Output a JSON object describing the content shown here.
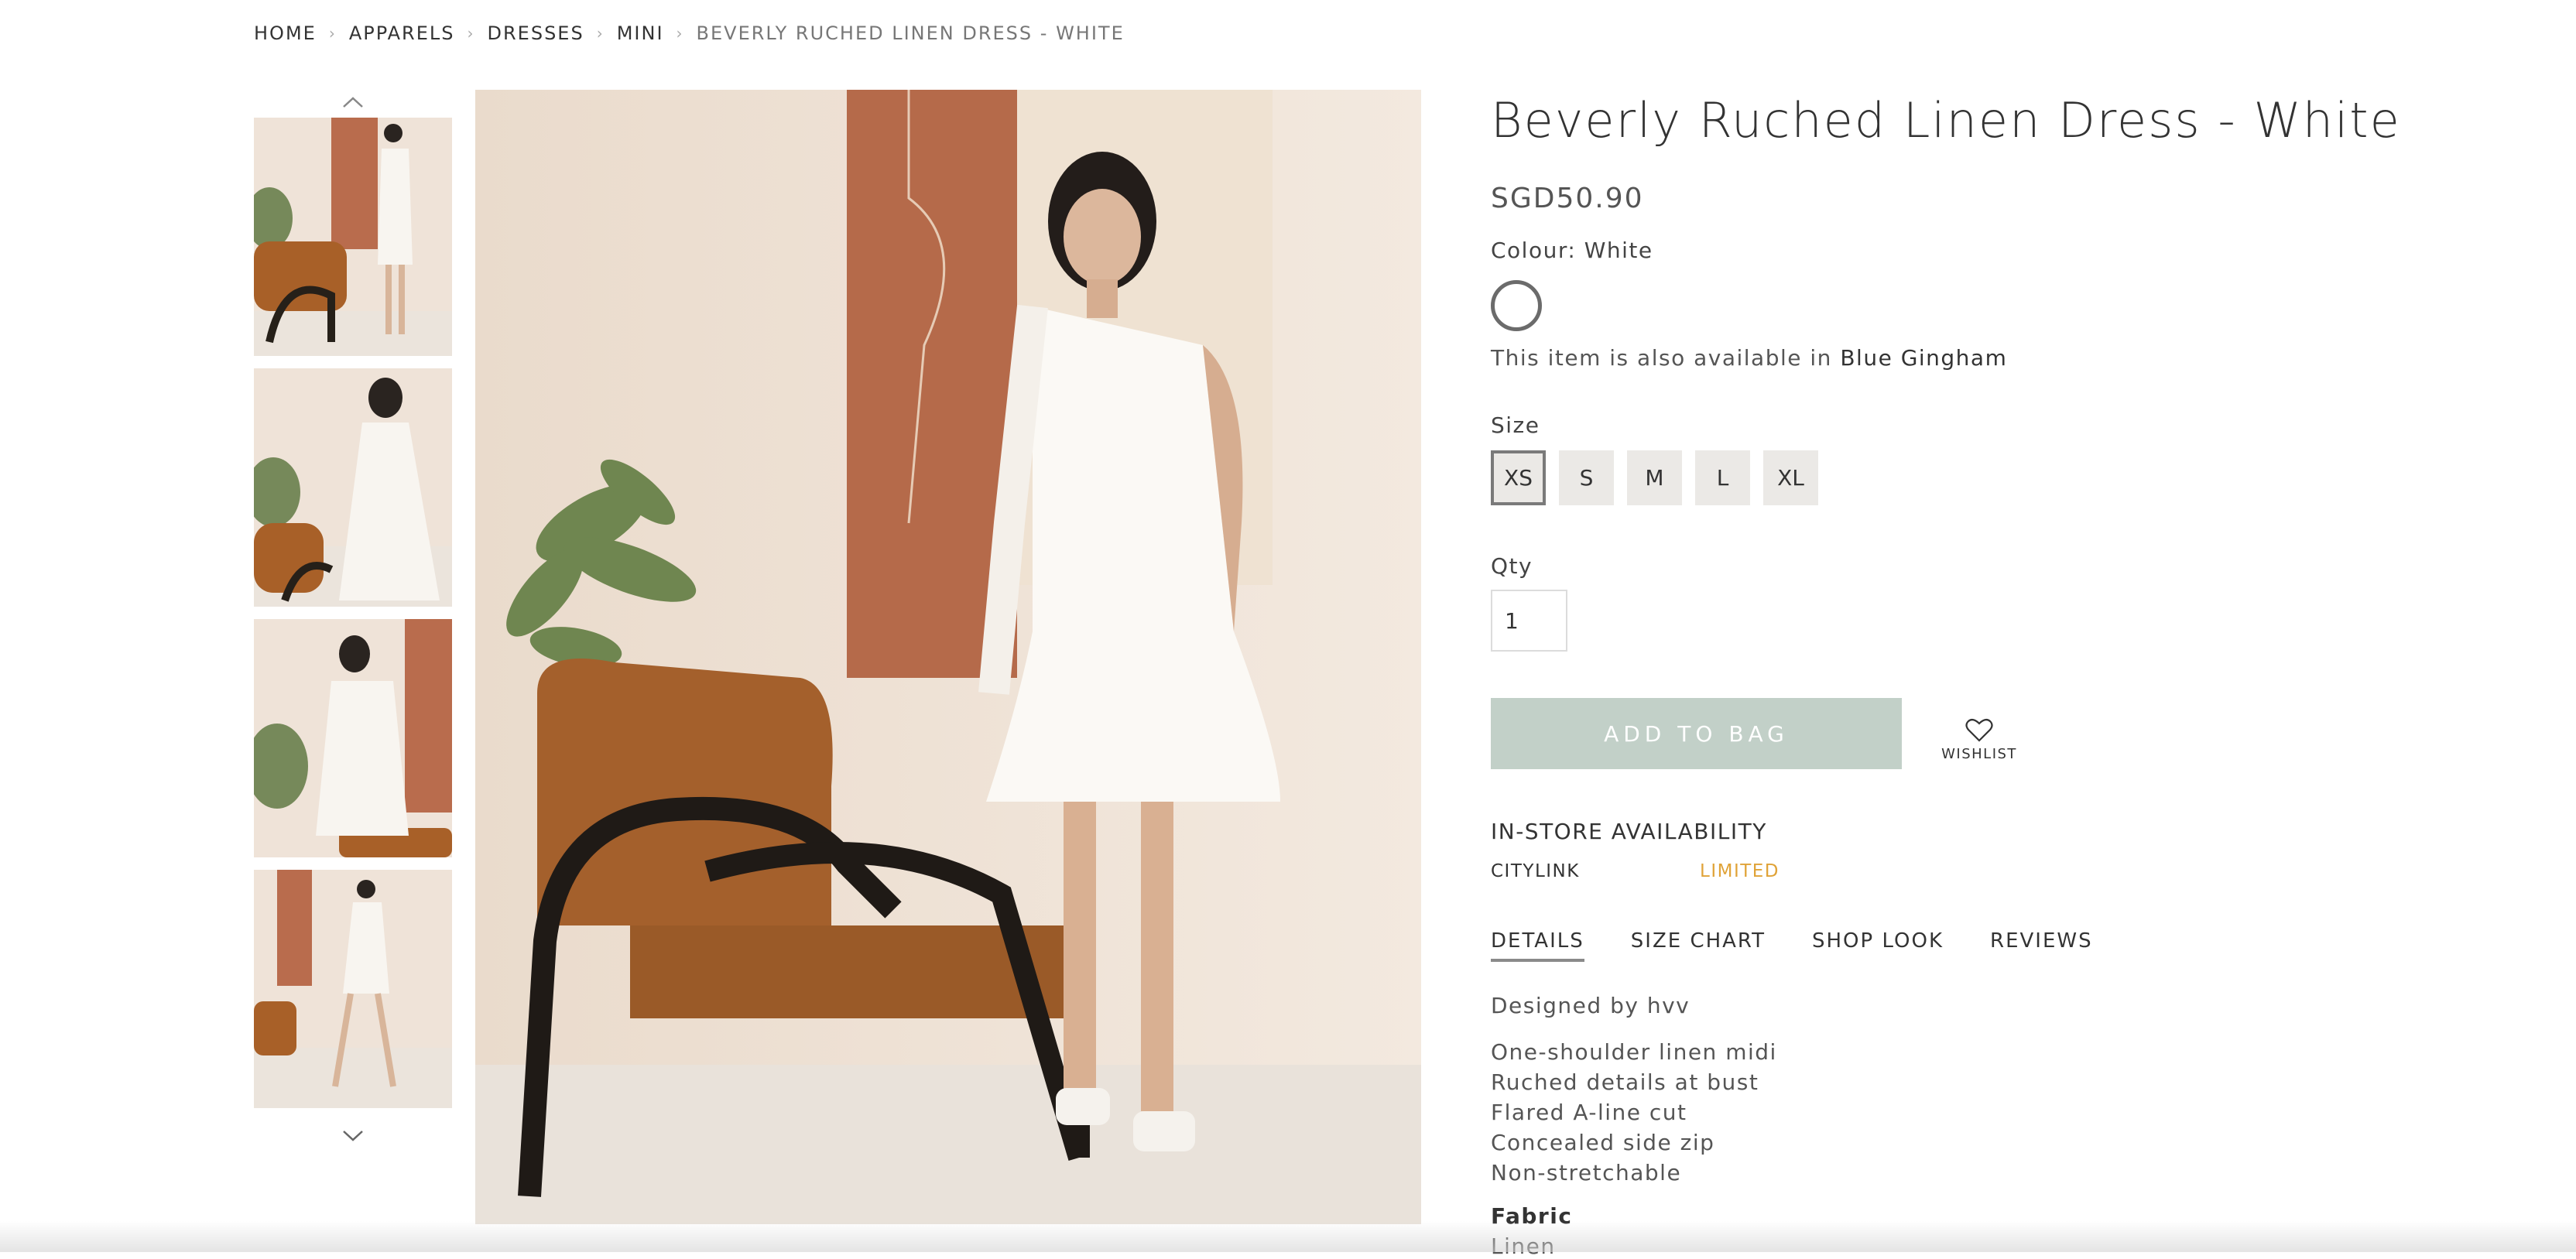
{
  "breadcrumb": {
    "items": [
      "HOME",
      "APPARELS",
      "DRESSES",
      "MINI"
    ],
    "current": "BEVERLY RUCHED LINEN DRESS - WHITE",
    "separator": "›"
  },
  "product": {
    "title": "Beverly Ruched Linen Dress - White",
    "price": "SGD50.90",
    "colour_label": "Colour: White",
    "also_available_prefix": "This item is also available in",
    "also_available_link": "Blue Gingham",
    "size_label": "Size",
    "sizes": [
      "XS",
      "S",
      "M",
      "L",
      "XL"
    ],
    "selected_size": "XS",
    "qty_label": "Qty",
    "qty_value": "1",
    "add_to_bag": "ADD TO BAG",
    "wishlist": "WISHLIST"
  },
  "instore": {
    "title": "IN-STORE AVAILABILITY",
    "store": "CITYLINK",
    "status": "LIMITED",
    "status_color": "#e0a338"
  },
  "tabs": [
    "DETAILS",
    "SIZE CHART",
    "SHOP LOOK",
    "REVIEWS"
  ],
  "details": {
    "designed_by": "Designed by hvv",
    "features": [
      "One-shoulder linen midi",
      "Ruched details at bust",
      "Flared A-line cut",
      "Concealed side zip",
      "Non-stretchable"
    ],
    "fabric_title": "Fabric",
    "fabric_value": "Linen"
  },
  "colors": {
    "accent_button": "#c2d0c8",
    "size_bg": "#ebe9e6",
    "limited": "#e0a338"
  }
}
